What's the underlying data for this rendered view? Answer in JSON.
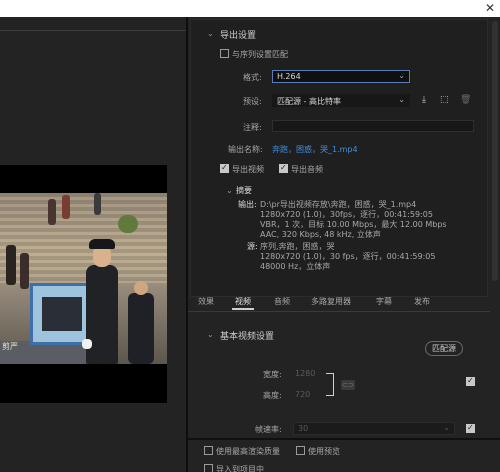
{
  "titlebar": {
    "close_icon": "✕"
  },
  "video": {
    "watermark": "剪严"
  },
  "export_settings": {
    "header": "导出设置",
    "match_sequence_label": "与序列设置匹配",
    "format_label": "格式:",
    "format_value": "H.264",
    "preset_label": "预设:",
    "preset_value": "匹配源 - 高比特率",
    "comment_label": "注释:",
    "output_name_label": "输出名称:",
    "output_name_value": "奔跑，困惑，哭_1.mp4",
    "export_video_label": "导出视频",
    "export_audio_label": "导出音频"
  },
  "summary": {
    "header": "摘要",
    "output_label": "输出:",
    "output_lines": [
      "D:\\pr导出视频存放\\奔跑，困惑，哭_1.mp4",
      "1280x720 (1.0)，30fps，逐行，00:41:59:05",
      "VBR，1 次，目标 10.00 Mbps，最大 12.00 Mbps",
      "AAC, 320 Kbps, 48  kHz, 立体声"
    ],
    "source_label": "源:",
    "source_lines": [
      "序列,奔跑，困惑，哭",
      "1280x720 (1.0)，30 fps，逐行，00:41:59:05",
      "48000  Hz，立体声"
    ]
  },
  "tabs": [
    "效果",
    "视频",
    "音频",
    "多路复用器",
    "字幕",
    "发布"
  ],
  "basic_video": {
    "header": "基本视频设置",
    "match_source_button": "匹配源",
    "width_label": "宽度:",
    "width_value": "1280",
    "height_label": "高度:",
    "height_value": "720",
    "frame_rate_label": "帧速率:",
    "frame_rate_value": "30"
  },
  "bottom": {
    "max_render_quality_label": "使用最高渲染质量",
    "use_previews_label": "使用预览",
    "import_project_label": "导入到项目中"
  }
}
